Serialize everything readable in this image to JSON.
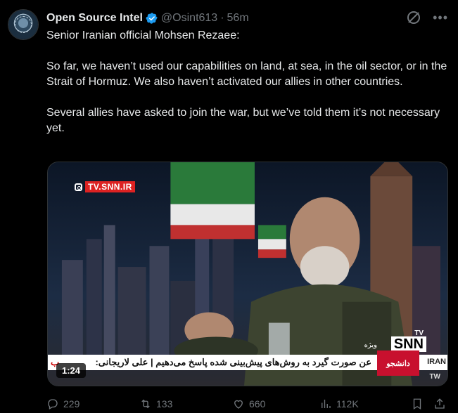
{
  "post": {
    "display_name": "Open Source Intel",
    "handle": "@Osint613",
    "separator": "·",
    "time": "56m",
    "text": [
      "Senior Iranian official Mohsen Rezaee:",
      "So far, we haven’t used our capabilities on land, at sea, in the oil sector, or in the Strait of Hormuz. We also haven’t activated our allies in other countries.",
      "Several allies have asked to join the war, but we’ve told them it’s not necessary yet."
    ]
  },
  "video": {
    "watermark": "TV.SNN.IR",
    "channel_logo": "SNN",
    "channel_tv": "TV",
    "ticker_text": "عن صورت گیرد به روش‌های پیش‌بینی شده پاسخ می‌دهیم | علی لاریجانی:",
    "ticker_left": "ب",
    "badge": "دانشجو",
    "sub_label": "ویژه",
    "iran_label": "IRAN",
    "tw_label": "TW",
    "duration": "1:24"
  },
  "actions": {
    "replies": "229",
    "reposts": "133",
    "likes": "660",
    "views": "112K"
  },
  "icons": [
    "verified-badge-icon",
    "grok-icon",
    "more-icon",
    "reply-icon",
    "repost-icon",
    "like-icon",
    "views-icon",
    "bookmark-icon",
    "share-icon"
  ],
  "colors": {
    "background": "#000000",
    "text": "#e7e9ea",
    "muted": "#71767b",
    "verified": "#1d9bf0"
  }
}
